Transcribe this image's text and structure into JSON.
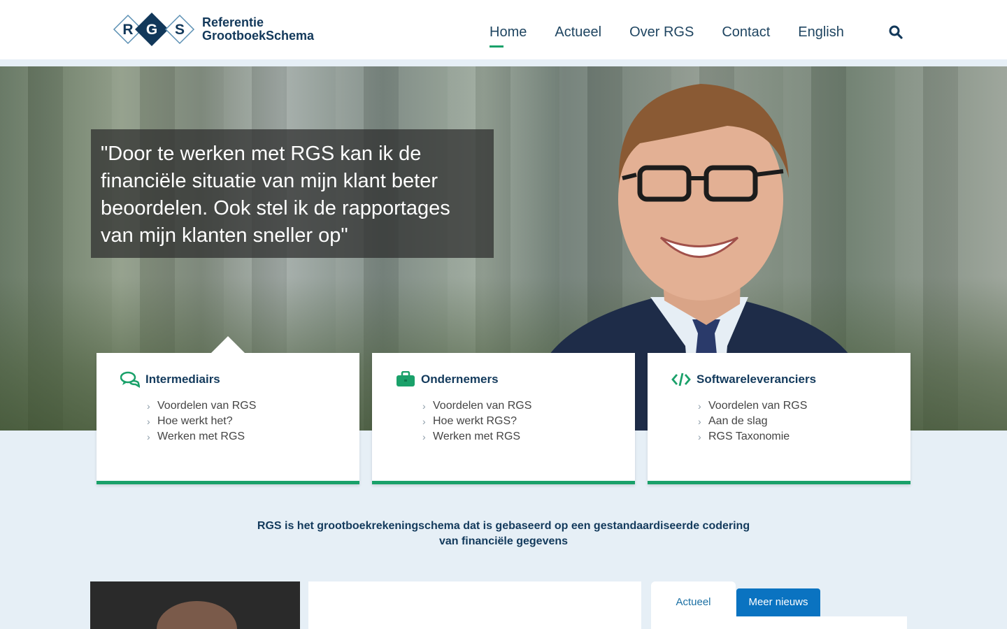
{
  "header": {
    "logo_mark_text": "RGS",
    "logo_line1": "Referentie",
    "logo_line2": "GrootboekSchema",
    "nav": [
      {
        "label": "Home",
        "active": true
      },
      {
        "label": "Actueel"
      },
      {
        "label": "Over RGS"
      },
      {
        "label": "Contact"
      },
      {
        "label": "English"
      }
    ],
    "search_icon": "search-icon"
  },
  "hero": {
    "quote": "\"Door te werken met RGS kan ik de financiële situatie van mijn klant beter beoordelen. Ook stel ik de rapportages van mijn klanten sneller op\""
  },
  "cards": [
    {
      "title": "Intermediairs",
      "icon": "chat-bubbles-icon",
      "links": [
        "Voordelen van RGS",
        "Hoe werkt het?",
        "Werken met RGS"
      ]
    },
    {
      "title": "Ondernemers",
      "icon": "briefcase-icon",
      "links": [
        "Voordelen van RGS",
        "Hoe werkt RGS?",
        "Werken met RGS"
      ]
    },
    {
      "title": "Softwareleveranciers",
      "icon": "code-icon",
      "links": [
        "Voordelen van RGS",
        "Aan de slag",
        "RGS Taxonomie"
      ]
    }
  ],
  "tagline": "RGS is het grootboekrekeningschema dat is gebaseerd op een gestandaardiseerde codering van financiële gegevens",
  "news": {
    "tab_active": "Actueel",
    "tab_more": "Meer nieuws"
  },
  "colors": {
    "accent": "#1aa16a",
    "navy": "#12385a",
    "link_blue": "#0a73c1"
  }
}
